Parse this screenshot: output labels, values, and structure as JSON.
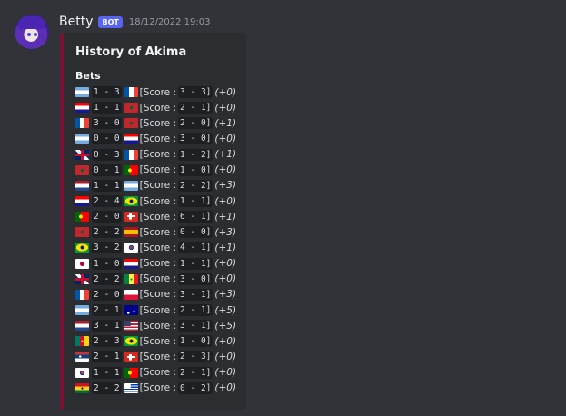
{
  "message": {
    "author": "Betty",
    "badge": "BOT",
    "timestamp": "18/12/2022 19:03"
  },
  "embed": {
    "title": "History of Akima",
    "field_name": "Bets",
    "accent_color": "#7a1233",
    "score_label": "[Score :",
    "bets": [
      {
        "home_flag": "argentina",
        "home_goals": "1",
        "away_goals": "3",
        "away_flag": "france",
        "score_home": "3",
        "score_away": "3]",
        "points": "(+0)"
      },
      {
        "home_flag": "croatia",
        "home_goals": "1",
        "away_goals": "1",
        "away_flag": "morocco",
        "score_home": "2",
        "score_away": "1]",
        "points": "(+0)"
      },
      {
        "home_flag": "france",
        "home_goals": "3",
        "away_goals": "0",
        "away_flag": "morocco",
        "score_home": "2",
        "score_away": "0]",
        "points": "(+1)"
      },
      {
        "home_flag": "argentina",
        "home_goals": "0",
        "away_goals": "0",
        "away_flag": "croatia",
        "score_home": "3",
        "score_away": "0]",
        "points": "(+0)"
      },
      {
        "home_flag": "england",
        "home_goals": "0",
        "away_goals": "3",
        "away_flag": "france",
        "score_home": "1",
        "score_away": "2]",
        "points": "(+1)"
      },
      {
        "home_flag": "morocco",
        "home_goals": "0",
        "away_goals": "1",
        "away_flag": "portugal",
        "score_home": "1",
        "score_away": "0]",
        "points": "(+0)"
      },
      {
        "home_flag": "netherlands",
        "home_goals": "1",
        "away_goals": "1",
        "away_flag": "argentina",
        "score_home": "2",
        "score_away": "2]",
        "points": "(+3)"
      },
      {
        "home_flag": "croatia",
        "home_goals": "2",
        "away_goals": "4",
        "away_flag": "brazil",
        "score_home": "1",
        "score_away": "1]",
        "points": "(+0)"
      },
      {
        "home_flag": "portugal",
        "home_goals": "2",
        "away_goals": "0",
        "away_flag": "switzerland",
        "score_home": "6",
        "score_away": "1]",
        "points": "(+1)"
      },
      {
        "home_flag": "morocco",
        "home_goals": "2",
        "away_goals": "2",
        "away_flag": "spain",
        "score_home": "0",
        "score_away": "0]",
        "points": "(+3)"
      },
      {
        "home_flag": "brazil",
        "home_goals": "3",
        "away_goals": "2",
        "away_flag": "south-korea",
        "score_home": "4",
        "score_away": "1]",
        "points": "(+1)"
      },
      {
        "home_flag": "japan",
        "home_goals": "1",
        "away_goals": "0",
        "away_flag": "croatia",
        "score_home": "1",
        "score_away": "1]",
        "points": "(+0)"
      },
      {
        "home_flag": "england",
        "home_goals": "2",
        "away_goals": "2",
        "away_flag": "senegal",
        "score_home": "3",
        "score_away": "0]",
        "points": "(+0)"
      },
      {
        "home_flag": "france",
        "home_goals": "2",
        "away_goals": "0",
        "away_flag": "poland",
        "score_home": "3",
        "score_away": "1]",
        "points": "(+3)"
      },
      {
        "home_flag": "argentina",
        "home_goals": "2",
        "away_goals": "1",
        "away_flag": "australia",
        "score_home": "2",
        "score_away": "1]",
        "points": "(+5)"
      },
      {
        "home_flag": "netherlands",
        "home_goals": "3",
        "away_goals": "1",
        "away_flag": "usa",
        "score_home": "3",
        "score_away": "1]",
        "points": "(+5)"
      },
      {
        "home_flag": "cameroon",
        "home_goals": "2",
        "away_goals": "3",
        "away_flag": "brazil",
        "score_home": "1",
        "score_away": "0]",
        "points": "(+0)"
      },
      {
        "home_flag": "serbia",
        "home_goals": "2",
        "away_goals": "1",
        "away_flag": "switzerland",
        "score_home": "2",
        "score_away": "3]",
        "points": "(+0)"
      },
      {
        "home_flag": "south-korea",
        "home_goals": "1",
        "away_goals": "1",
        "away_flag": "portugal",
        "score_home": "2",
        "score_away": "1]",
        "points": "(+0)"
      },
      {
        "home_flag": "ghana",
        "home_goals": "2",
        "away_goals": "2",
        "away_flag": "uruguay",
        "score_home": "0",
        "score_away": "2]",
        "points": "(+0)"
      }
    ]
  }
}
